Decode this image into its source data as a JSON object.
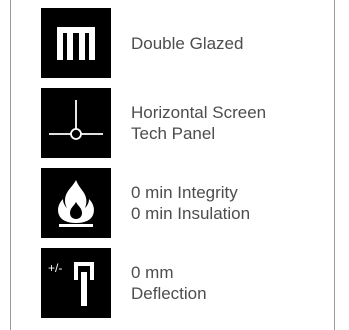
{
  "specs": [
    {
      "icon": "double-glazed-icon",
      "lines": [
        "Double Glazed"
      ]
    },
    {
      "icon": "horizontal-screen-icon",
      "lines": [
        "Horizontal Screen",
        "Tech Panel"
      ]
    },
    {
      "icon": "fire-icon",
      "lines": [
        "0 min Integrity",
        "0 min Insulation"
      ]
    },
    {
      "icon": "deflection-icon",
      "icon_text": "+/-",
      "lines": [
        "0 mm",
        "Deflection"
      ]
    }
  ]
}
